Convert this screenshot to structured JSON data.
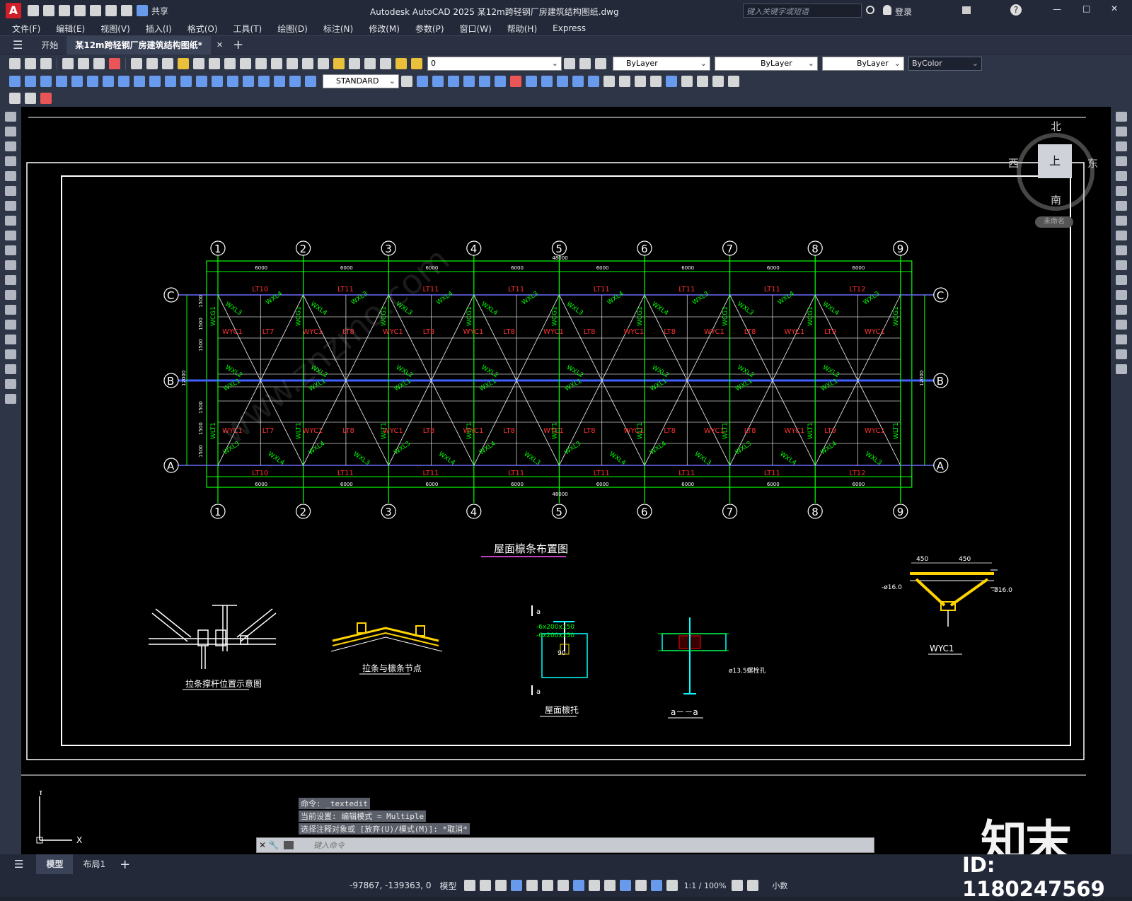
{
  "titlebar": {
    "app_title": "Autodesk AutoCAD 2025    某12m跨轻钢厂房建筑结构图纸.dwg",
    "share_label": "共享",
    "search_placeholder": "键入关键字或短语",
    "login_label": "登录"
  },
  "menubar": [
    "文件(F)",
    "编辑(E)",
    "视图(V)",
    "插入(I)",
    "格式(O)",
    "工具(T)",
    "绘图(D)",
    "标注(N)",
    "修改(M)",
    "参数(P)",
    "窗口(W)",
    "帮助(H)",
    "Express"
  ],
  "tabs": {
    "start": "开始",
    "drawing": "某12m跨轻钢厂房建筑结构图纸*"
  },
  "toolbar": {
    "layer_value": "0",
    "color_value": "ByLayer",
    "linetype_value": "ByLayer",
    "lineweight_value": "ByLayer",
    "plotstyle_value": "ByColor",
    "textstyle_value": "STANDARD"
  },
  "viewcube": {
    "north": "北",
    "south": "南",
    "east": "东",
    "west": "西",
    "top": "上",
    "wcs": "未命名"
  },
  "drawing": {
    "grid_numbers": [
      "1",
      "2",
      "3",
      "4",
      "5",
      "6",
      "7",
      "8",
      "9"
    ],
    "grid_letters": [
      "C",
      "B",
      "A"
    ],
    "span_dim": "6000",
    "total_dim": "48000",
    "main_title": "屋面檩条布置图",
    "detail1_title": "拉条撑杆位置示意图",
    "detail2_title": "拉条与檩条节点",
    "detail3_title": "屋面檩托",
    "detail4_title": "a－－a",
    "detail5_title": "WYC1",
    "purlin_labels_top": [
      "LT10",
      "LT11",
      "LT11",
      "LT11",
      "LT11",
      "LT11",
      "LT11",
      "LT12"
    ],
    "red_labels": [
      "WYC1",
      "LT7",
      "WYC1",
      "LT8",
      "WYC1",
      "LT8",
      "WYC1",
      "LT8",
      "WYC1",
      "LT8",
      "WYC1",
      "LT8",
      "WYC1",
      "LT8",
      "WYC1",
      "LT9",
      "WYC1"
    ],
    "green_labels": [
      "WXL3",
      "WXL4",
      "WLT1",
      "WCG1",
      "WXL2",
      "WXL1"
    ],
    "dim_1500": "1500",
    "dim_12000": "12000"
  },
  "command": {
    "history": [
      "命令: _textedit",
      "当前设置: 编辑模式 = Multiple",
      "选择注释对象或 [放弃(U)/模式(M)]: *取消*"
    ],
    "placeholder": "键入命令"
  },
  "layout_tabs": [
    "模型",
    "布局1"
  ],
  "statusbar": {
    "coords": "-97867, -139363, 0",
    "mode": "模型",
    "scale": "1:1 / 100%",
    "units": "小数"
  },
  "watermark": {
    "brand": "知末",
    "id_text": "ID: 1180247569",
    "site": "www.znzmo.com"
  }
}
